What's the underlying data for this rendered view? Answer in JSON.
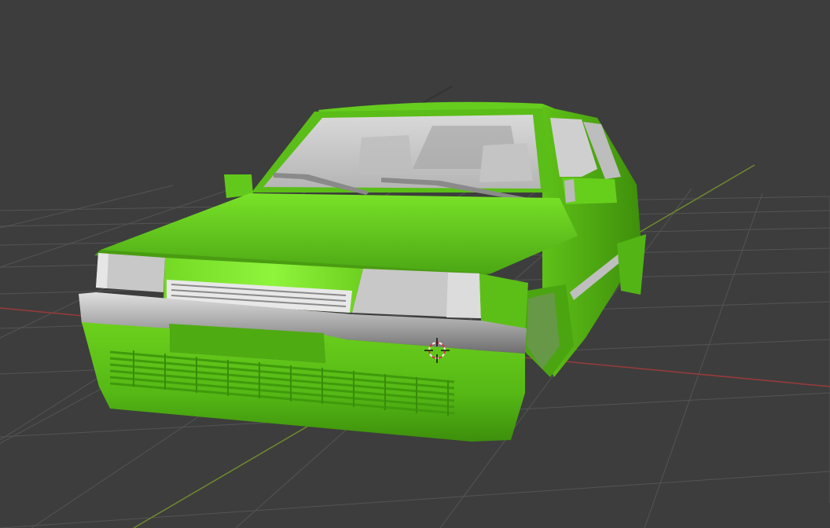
{
  "viewport": {
    "background_color": "#3d3d3d",
    "grid_color": "#545454",
    "x_axis_color": "#9b3a3a",
    "y_axis_color": "#6f8a2e"
  },
  "model": {
    "body_color": "#6fd41e",
    "body_highlight": "#8ef23a",
    "body_shadow": "#3f9a0c",
    "trim_color": "#c9c9c9",
    "glass_color": "#cfcfcf"
  },
  "gizmo": {
    "icon": "3d-cursor-icon",
    "ring_color": "#d33a3a",
    "ring_alt_color": "#f0f0f0"
  }
}
